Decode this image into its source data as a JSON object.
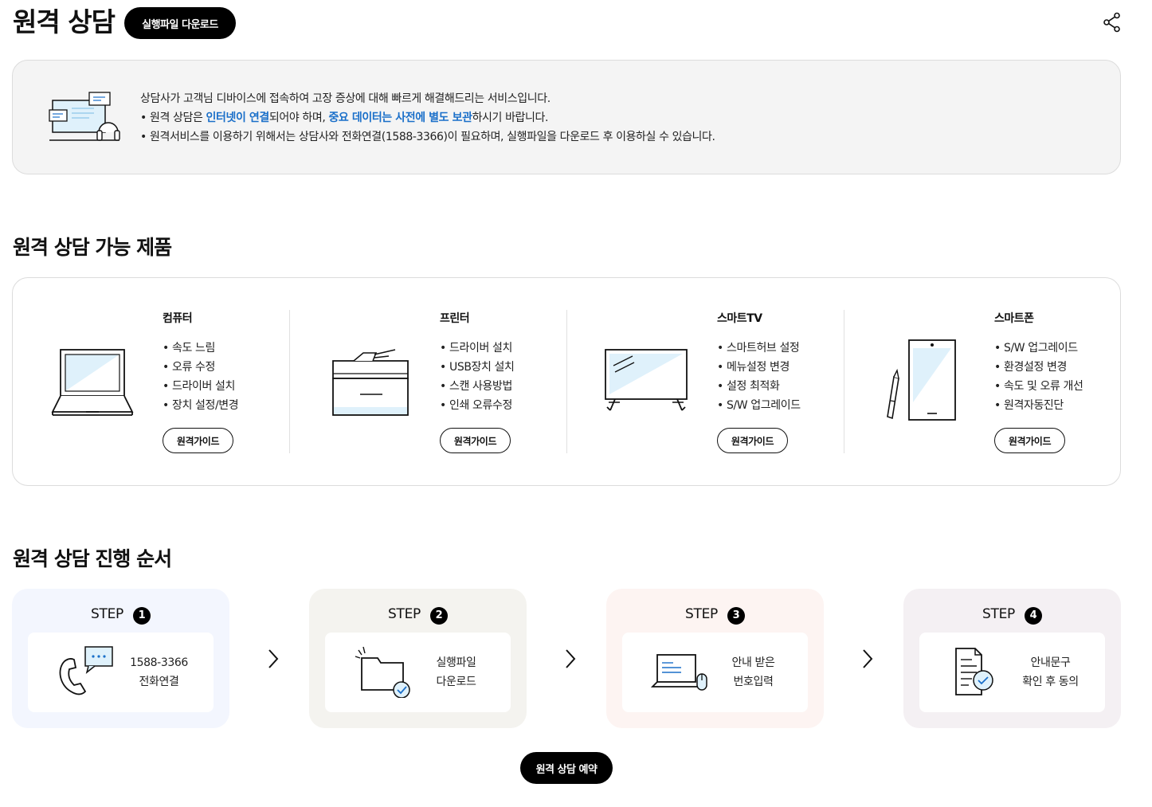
{
  "header": {
    "title": "원격 상담",
    "download_label": "실행파일 다운로드"
  },
  "intro": {
    "line1": "상담사가 고객님 디바이스에 접속하여 고장 증상에 대해 빠르게 해결해드리는 서비스입니다.",
    "line2_a": "원격 상담은 ",
    "line2_hl1": "인터넷이 연결",
    "line2_b": "되어야 하며, ",
    "line2_hl2": "중요 데이터는 사전에 별도 보관",
    "line2_c": "하시기 바랍니다.",
    "line3": "원격서비스를 이용하기 위해서는 상담사와 전화연결(1588-3366)이 필요하며, 실행파일을 다운로드 후 이용하실 수 있습니다."
  },
  "products_section": {
    "title": "원격 상담 가능 제품",
    "items": [
      {
        "name": "컴퓨터",
        "features": [
          "속도 느림",
          "오류 수정",
          "드라이버 설치",
          "장치 설정/변경"
        ],
        "button": "원격가이드",
        "icon": "laptop-icon"
      },
      {
        "name": "프린터",
        "features": [
          "드라이버 설치",
          "USB장치 설치",
          "스캔 사용방법",
          "인쇄 오류수정"
        ],
        "button": "원격가이드",
        "icon": "printer-icon"
      },
      {
        "name": "스마트TV",
        "features": [
          "스마트허브 설정",
          "메뉴설정 변경",
          "설정 최적화",
          "S/W 업그레이드"
        ],
        "button": "원격가이드",
        "icon": "tv-icon"
      },
      {
        "name": "스마트폰",
        "features": [
          "S/W 업그레이드",
          "환경설정 변경",
          "속도 및 오류 개선",
          "원격자동진단"
        ],
        "button": "원격가이드",
        "icon": "smartphone-icon"
      }
    ]
  },
  "steps_section": {
    "title": "원격 상담 진행 순서",
    "steps": [
      {
        "label": "STEP",
        "num": "1",
        "line1": "1588-3366",
        "line2": "전화연결",
        "icon": "phone-chat-icon",
        "bg": "#f3f6fe"
      },
      {
        "label": "STEP",
        "num": "2",
        "line1": "실행파일",
        "line2": "다운로드",
        "icon": "folder-check-icon",
        "bg": "#f4f3ef"
      },
      {
        "label": "STEP",
        "num": "3",
        "line1": "안내 받은",
        "line2": "번호입력",
        "icon": "laptop-mouse-icon",
        "bg": "#fdf4f2"
      },
      {
        "label": "STEP",
        "num": "4",
        "line1": "안내문구",
        "line2": "확인 후 동의",
        "icon": "document-check-icon",
        "bg": "#f4f0f3"
      }
    ]
  },
  "reserve_label": "원격 상담 예약",
  "colors": {
    "highlight": "#1a6fc9",
    "illustration_fill": "#dff1fb"
  }
}
